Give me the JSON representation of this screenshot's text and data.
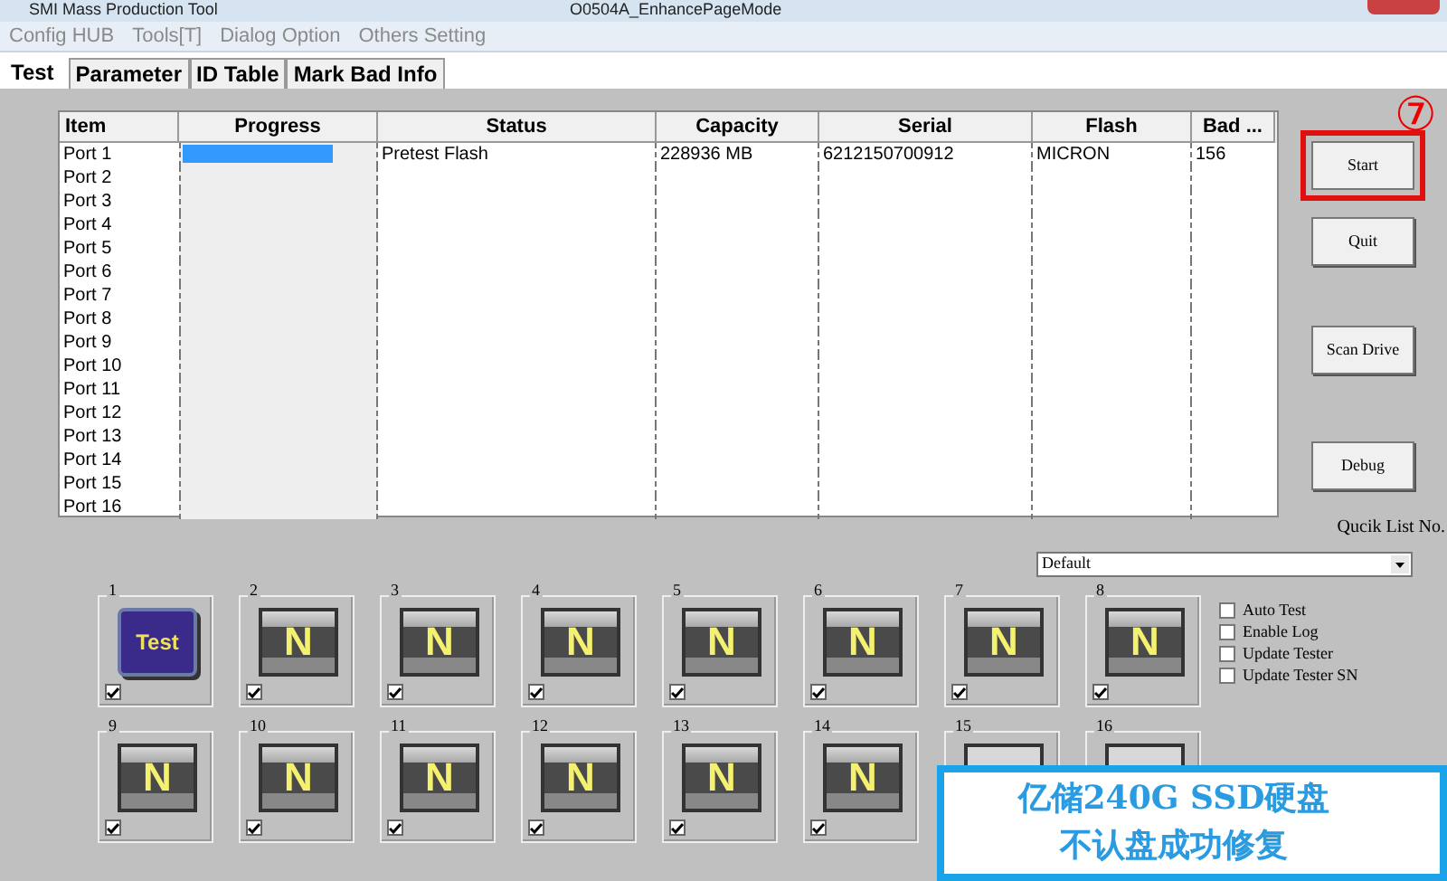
{
  "window": {
    "title": "SMI Mass Production Tool",
    "subtitle": "O0504A_EnhancePageMode"
  },
  "menu": [
    "Config HUB",
    "Tools[T]",
    "Dialog Option",
    "Others Setting"
  ],
  "tabs": [
    {
      "label": "Test",
      "selected": true
    },
    {
      "label": "Parameter",
      "selected": false
    },
    {
      "label": "ID Table",
      "selected": false
    },
    {
      "label": "Mark Bad Info",
      "selected": false
    }
  ],
  "table": {
    "columns": [
      "Item",
      "Progress",
      "Status",
      "Capacity",
      "Serial",
      "Flash",
      "Bad ..."
    ],
    "rows": [
      {
        "item": "Port 1",
        "level": 0.78,
        "status": "Pretest Flash",
        "capacity": "228936 MB",
        "serial": "6212150700912",
        "flash": "MICRON",
        "bad": "156"
      },
      {
        "item": "Port 2"
      },
      {
        "item": "Port 3"
      },
      {
        "item": "Port 4"
      },
      {
        "item": "Port 5"
      },
      {
        "item": "Port 6"
      },
      {
        "item": "Port 7"
      },
      {
        "item": "Port 8"
      },
      {
        "item": "Port 9"
      },
      {
        "item": "Port 10"
      },
      {
        "item": "Port 11"
      },
      {
        "item": "Port 12"
      },
      {
        "item": "Port 13"
      },
      {
        "item": "Port 14"
      },
      {
        "item": "Port 15"
      },
      {
        "item": "Port 16"
      }
    ]
  },
  "annotation": {
    "mark": "⑦"
  },
  "buttons": [
    {
      "label": "Start",
      "highlighted": true
    },
    {
      "label": "Quit",
      "highlighted": false
    },
    {
      "label": "Scan Drive",
      "highlighted": false
    },
    {
      "label": "Debug",
      "highlighted": false
    }
  ],
  "quick_list": {
    "label": "Qucik List No.",
    "value": "Default"
  },
  "options": [
    {
      "label": "Auto Test",
      "checked": false
    },
    {
      "label": "Enable Log",
      "checked": false
    },
    {
      "label": "Update Tester",
      "checked": false
    },
    {
      "label": "Update Tester SN",
      "checked": false
    }
  ],
  "ports": [
    {
      "label": "1",
      "kind": "test",
      "text": "Test",
      "checked": true
    },
    {
      "label": "2",
      "kind": "none",
      "text": "N",
      "checked": true
    },
    {
      "label": "3",
      "kind": "none",
      "text": "N",
      "checked": true
    },
    {
      "label": "4",
      "kind": "none",
      "text": "N",
      "checked": true
    },
    {
      "label": "5",
      "kind": "none",
      "text": "N",
      "checked": true
    },
    {
      "label": "6",
      "kind": "none",
      "text": "N",
      "checked": true
    },
    {
      "label": "7",
      "kind": "none",
      "text": "N",
      "checked": true
    },
    {
      "label": "8",
      "kind": "none",
      "text": "N",
      "checked": true
    },
    {
      "label": "9",
      "kind": "none",
      "text": "N",
      "checked": true
    },
    {
      "label": "10",
      "kind": "none",
      "text": "N",
      "checked": true
    },
    {
      "label": "11",
      "kind": "none",
      "text": "N",
      "checked": true
    },
    {
      "label": "12",
      "kind": "none",
      "text": "N",
      "checked": true
    },
    {
      "label": "13",
      "kind": "none",
      "text": "N",
      "checked": true
    },
    {
      "label": "14",
      "kind": "none",
      "text": "N",
      "checked": true
    },
    {
      "label": "15",
      "kind": "hidden"
    },
    {
      "label": "16",
      "kind": "hidden"
    }
  ],
  "caption": {
    "lines": [
      "亿储240G SSD硬盘",
      "不认盘成功修复"
    ]
  }
}
